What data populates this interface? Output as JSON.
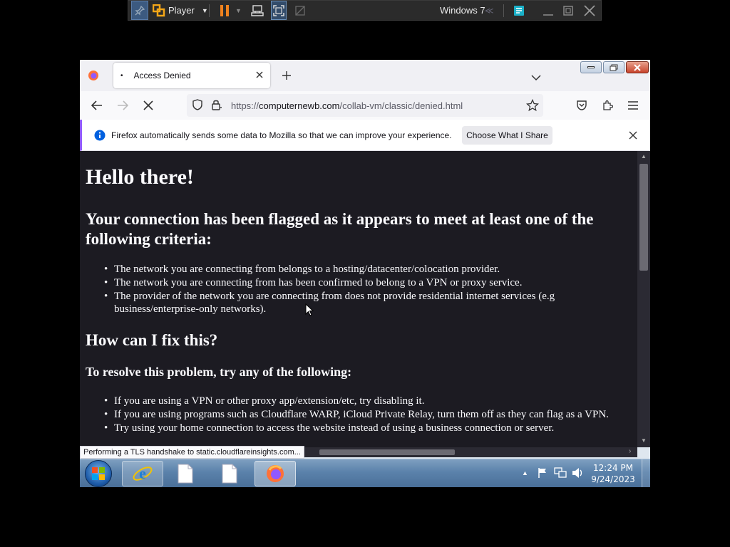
{
  "vmware": {
    "player_label": "Player",
    "vm_name": "Windows 7"
  },
  "firefox": {
    "tab": {
      "title": "Access Denied"
    },
    "url": {
      "prefix": "https://",
      "domain": "computernewb.com",
      "path": "/collab-vm/classic/denied.html"
    },
    "notice": {
      "text": "Firefox automatically sends some data to Mozilla so that we can improve your experience.",
      "button_label": "Choose What I Share"
    },
    "status_text": "Performing a TLS handshake to static.cloudflareinsights.com..."
  },
  "page": {
    "heading": "Hello there!",
    "subheading": "Your connection has been flagged as it appears to meet at least one of the following criteria:",
    "criteria": [
      "The network you are connecting from belongs to a hosting/datacenter/colocation provider.",
      "The network you are connecting from has been confirmed to belong to a VPN or proxy service.",
      "The provider of the network you are connecting from does not provide residential internet services (e.g business/enterprise-only networks)."
    ],
    "fix_heading": "How can I fix this?",
    "resolve_heading": "To resolve this problem, try any of the following:",
    "fixes": [
      "If you are using a VPN or other proxy app/extension/etc, try disabling it.",
      "If you are using programs such as Cloudflare WARP, iCloud Private Relay, turn them off as they can flag as a VPN.",
      "Try using your home connection to access the website instead of using a business connection or server."
    ]
  },
  "taskbar": {
    "time": "12:24 PM",
    "date": "9/24/2023"
  },
  "colors": {
    "page_bg": "#1c1b22",
    "page_text": "#fbfbfe",
    "firefox_accent": "#0060df",
    "pause_orange": "#f0821e"
  }
}
